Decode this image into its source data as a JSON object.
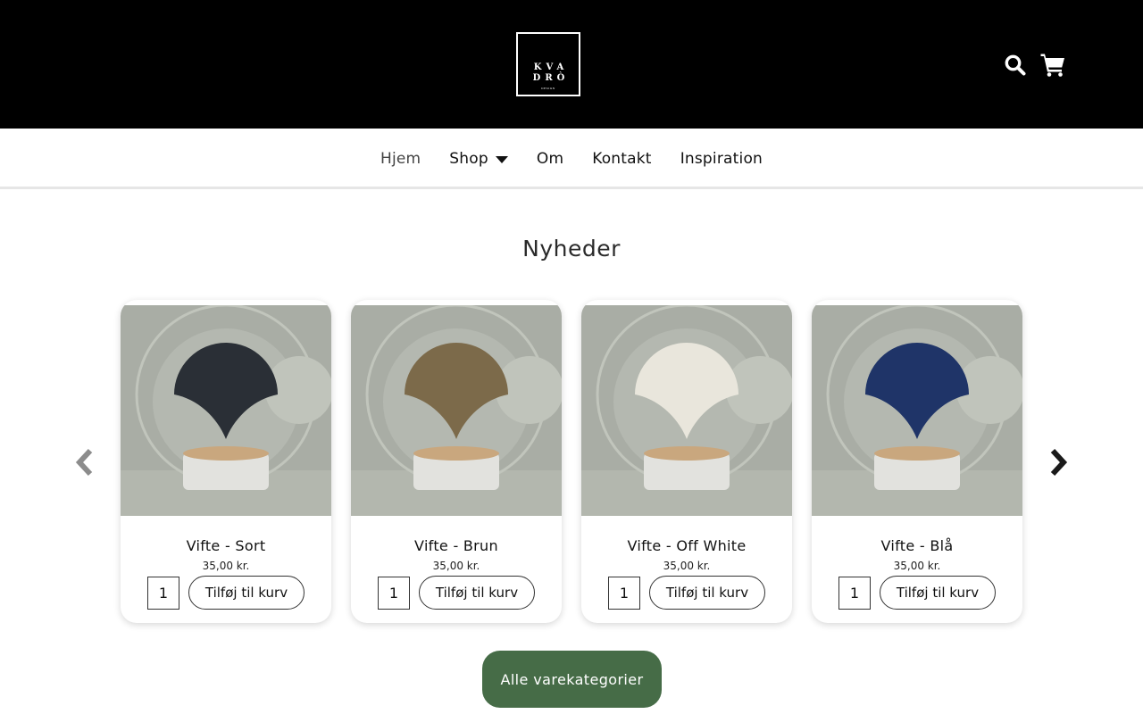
{
  "header": {
    "logo": {
      "line1": "KVA",
      "line2": "DRÒ",
      "line3": "DESIGN"
    },
    "icons": {
      "search": "search-icon",
      "cart": "cart-icon"
    }
  },
  "nav": {
    "items": [
      {
        "label": "Hjem",
        "active": true
      },
      {
        "label": "Shop",
        "has_dropdown": true
      },
      {
        "label": "Om"
      },
      {
        "label": "Kontakt"
      },
      {
        "label": "Inspiration"
      }
    ]
  },
  "section": {
    "title": "Nyheder"
  },
  "carousel": {
    "prev_icon": "chevron-left-icon",
    "next_icon": "chevron-right-icon",
    "products": [
      {
        "name": "Vifte - Sort",
        "price": "35,00 kr.",
        "qty": "1",
        "add_label": "Tilføj til kurv",
        "color": "#2a2f36"
      },
      {
        "name": "Vifte - Brun",
        "price": "35,00 kr.",
        "qty": "1",
        "add_label": "Tilføj til kurv",
        "color": "#7c6a4a"
      },
      {
        "name": "Vifte - Off White",
        "price": "35,00 kr.",
        "qty": "1",
        "add_label": "Tilføj til kurv",
        "color": "#e9e6dc"
      },
      {
        "name": "Vifte - Blå",
        "price": "35,00 kr.",
        "qty": "1",
        "add_label": "Tilføj til kurv",
        "color": "#1f3468"
      }
    ]
  },
  "cta": {
    "label": "Alle varekategorier",
    "color": "#466c47"
  }
}
